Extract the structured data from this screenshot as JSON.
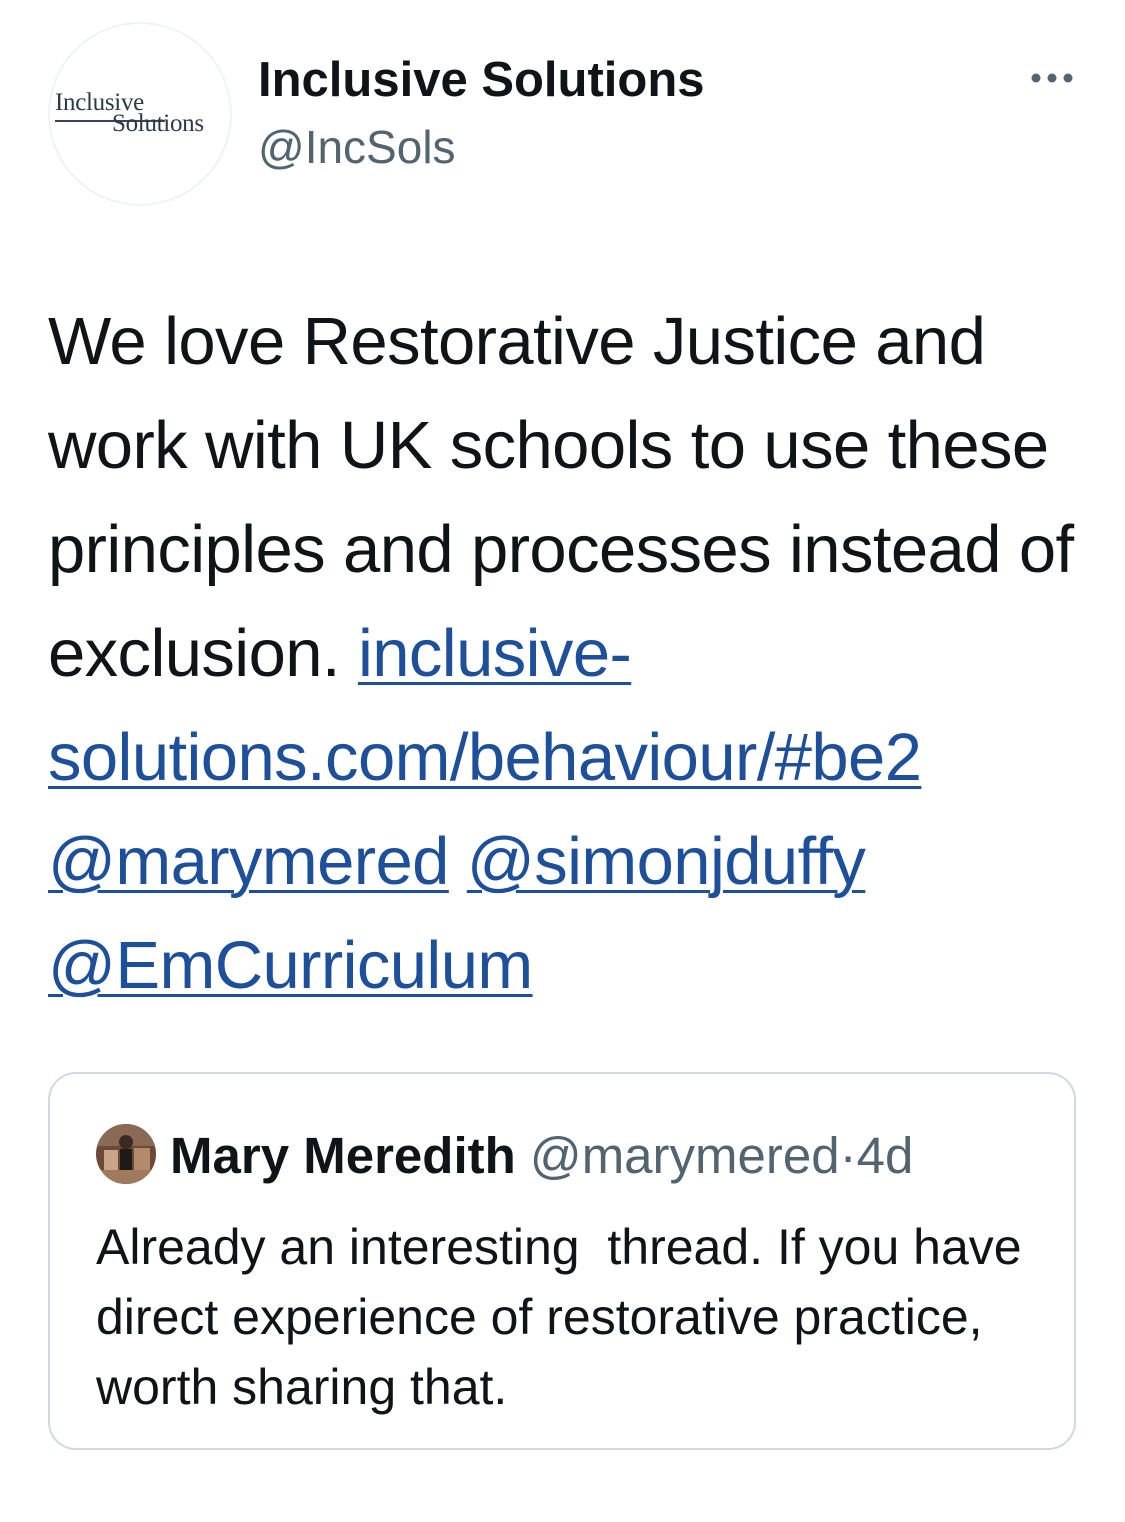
{
  "tweet": {
    "author": {
      "display_name": "Inclusive Solutions",
      "handle": "@IncSols",
      "avatar_logo": {
        "line1": "Inclusive",
        "line2": "Solutions"
      }
    },
    "more_icon": "ellipsis-icon",
    "text": "We love Restorative Justice and work with UK schools to use these principles and processes instead of exclusion.",
    "link": "inclusive-solutions.com/behaviour/#be2",
    "mentions": [
      "@marymered",
      "@simonjduffy",
      "@EmCurriculum"
    ],
    "link_color": "#1d4f9a"
  },
  "quoted_tweet": {
    "author_name": "Mary Meredith",
    "handle": "@marymered",
    "separator": "·",
    "time": "4d",
    "text": "Already an interesting  thread. If you have direct experience of restorative practice, worth sharing that."
  }
}
